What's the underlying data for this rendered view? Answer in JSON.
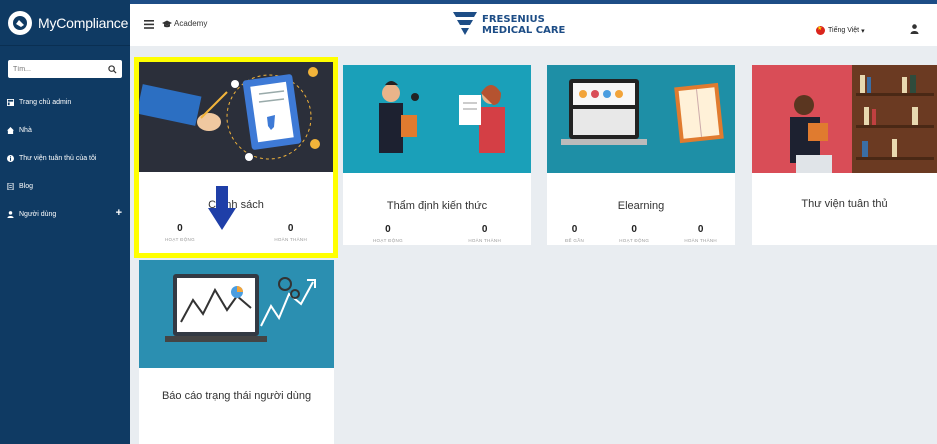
{
  "sidebar": {
    "brand": "MyCompliance",
    "search_placeholder": "Tìm...",
    "items": [
      {
        "label": "Trang chủ admin",
        "icon": "dashboard-icon"
      },
      {
        "label": "Nhà",
        "icon": "home-icon"
      },
      {
        "label": "Thư viện tuân thủ của tôi",
        "icon": "info-icon"
      },
      {
        "label": "Blog",
        "icon": "document-icon"
      },
      {
        "label": "Người dùng",
        "icon": "user-icon",
        "expand": "+"
      }
    ]
  },
  "topbar": {
    "academy": "Academy",
    "logo_line1": "FRESENIUS",
    "logo_line2": "MEDICAL CARE",
    "language": "Tiếng Việt",
    "language_caret": "▾"
  },
  "cards": [
    {
      "title": "Chính sách",
      "stats": [
        {
          "value": "0",
          "label": "HOẠT ĐỘNG"
        },
        {
          "value": "0",
          "label": "HOÀN THÀNH"
        }
      ]
    },
    {
      "title": "Thẩm định kiến thức",
      "stats": [
        {
          "value": "0",
          "label": "HOẠT ĐỘNG"
        },
        {
          "value": "0",
          "label": "HOÀN THÀNH"
        }
      ]
    },
    {
      "title": "Elearning",
      "stats": [
        {
          "value": "0",
          "label": "ĐẾ GẦN"
        },
        {
          "value": "0",
          "label": "HOẠT ĐỘNG"
        },
        {
          "value": "0",
          "label": "HOÀN THÀNH"
        }
      ]
    },
    {
      "title": "Thư viện tuân thủ"
    },
    {
      "title": "Báo cáo trạng thái người dùng"
    }
  ],
  "colors": {
    "sidebar_bg": "#0f3a63",
    "brand_blue": "#1d4d86",
    "highlight": "#ffff00",
    "arrow": "#1f3fa8"
  }
}
